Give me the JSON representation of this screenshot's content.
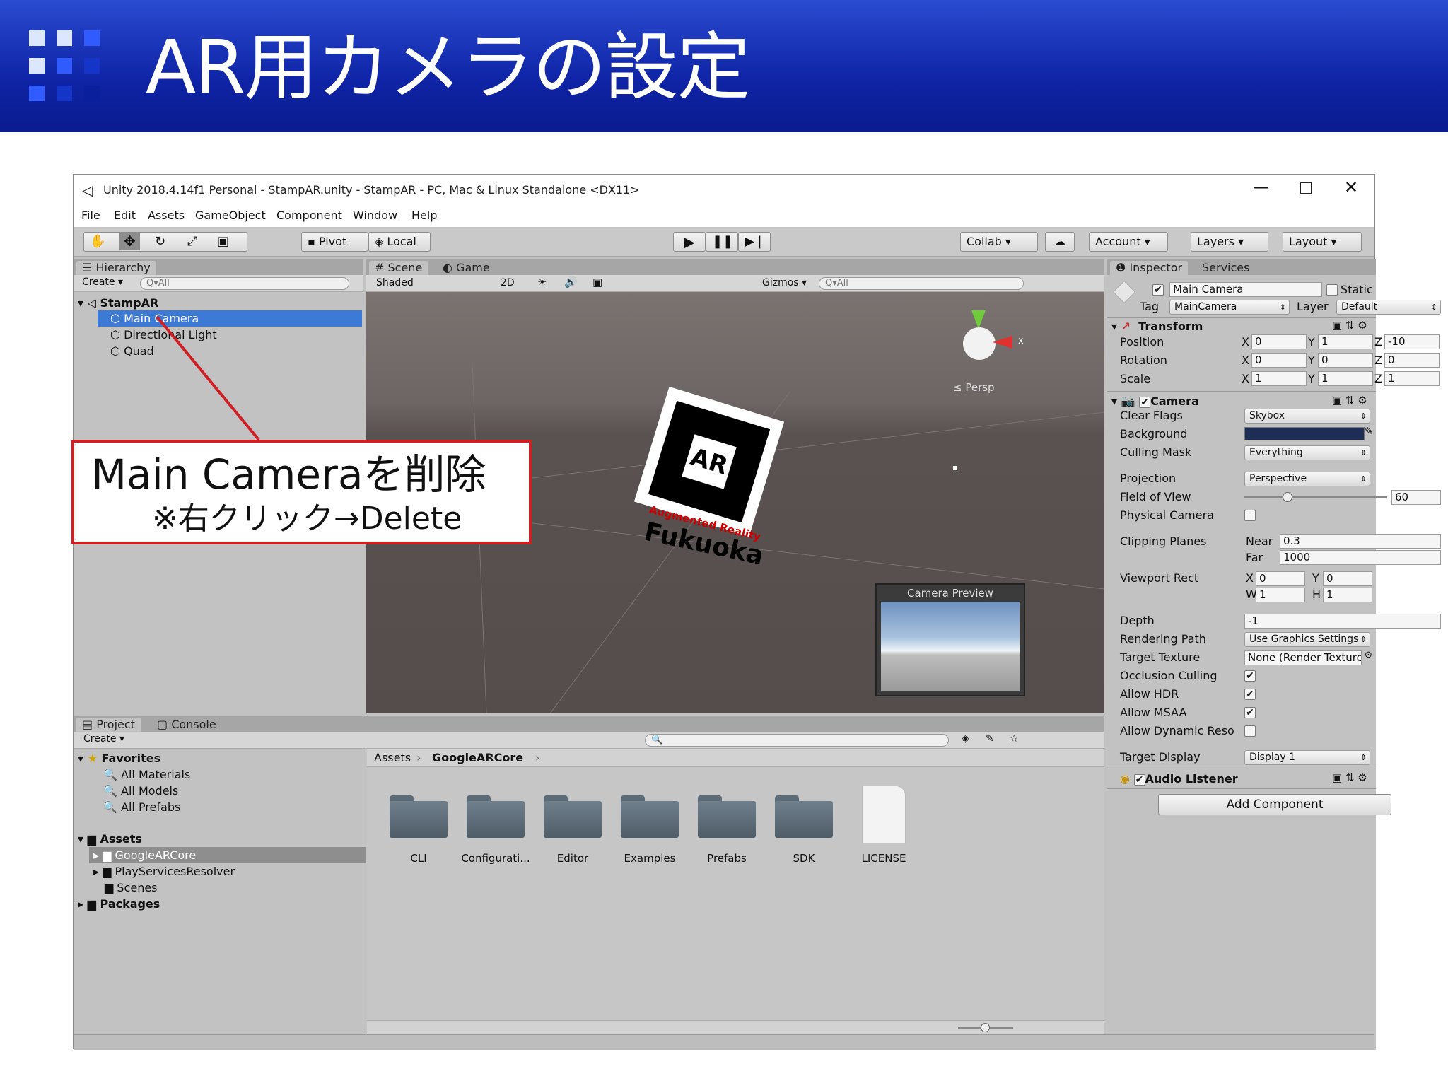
{
  "slide": {
    "title": "AR用カメラの設定"
  },
  "window": {
    "title": "Unity 2018.4.14f1 Personal - StampAR.unity - StampAR - PC, Mac & Linux Standalone <DX11>",
    "menu": [
      "File",
      "Edit",
      "Assets",
      "GameObject",
      "Component",
      "Window",
      "Help"
    ],
    "toolbar": {
      "pivot": "Pivot",
      "local": "Local",
      "collab": "Collab ▾",
      "account": "Account",
      "layers": "Layers",
      "layout": "Layout"
    }
  },
  "hierarchy": {
    "tab": "Hierarchy",
    "create": "Create ▾",
    "search": "Q▾All",
    "scene": "StampAR",
    "items": [
      "Main Camera",
      "Directional Light",
      "Quad"
    ]
  },
  "scene": {
    "tabs": [
      "Scene",
      "Game"
    ],
    "shading": "Shaded",
    "mode2d": "2D",
    "gizmos": "Gizmos ▾",
    "search": "Q▾All",
    "persp": "≤ Persp",
    "marker_text": "AR",
    "marker_sub": "Augmented Reality",
    "marker_city": "Fukuoka",
    "preview_title": "Camera Preview"
  },
  "callout": {
    "main": "Main Cameraを削除",
    "sub": "※右クリック→Delete"
  },
  "inspector": {
    "tabs": [
      "Inspector",
      "Services"
    ],
    "object_name": "Main Camera",
    "static": "Static",
    "tag_label": "Tag",
    "tag": "MainCamera",
    "layer_label": "Layer",
    "layer": "Default",
    "transform": {
      "title": "Transform",
      "rows": [
        {
          "label": "Position",
          "x": "0",
          "y": "1",
          "z": "-10"
        },
        {
          "label": "Rotation",
          "x": "0",
          "y": "0",
          "z": "0"
        },
        {
          "label": "Scale",
          "x": "1",
          "y": "1",
          "z": "1"
        }
      ]
    },
    "camera": {
      "title": "Camera",
      "clear_flags_label": "Clear Flags",
      "clear_flags": "Skybox",
      "background_label": "Background",
      "background_color": "#1d2d55",
      "culling_label": "Culling Mask",
      "culling": "Everything",
      "projection_label": "Projection",
      "projection": "Perspective",
      "fov_label": "Field of View",
      "fov": "60",
      "fov_fraction": 0.3,
      "physical_label": "Physical Camera",
      "clipping_label": "Clipping Planes",
      "near_label": "Near",
      "near": "0.3",
      "far_label": "Far",
      "far": "1000",
      "viewport_label": "Viewport Rect",
      "vx": "0",
      "vy": "0",
      "vw": "1",
      "vh": "1",
      "depth_label": "Depth",
      "depth": "-1",
      "rendering_label": "Rendering Path",
      "rendering": "Use Graphics Settings",
      "target_tex_label": "Target Texture",
      "target_tex": "None (Render Texture)",
      "occlusion_label": "Occlusion Culling",
      "hdr_label": "Allow HDR",
      "msaa_label": "Allow MSAA",
      "dynres_label": "Allow Dynamic Reso",
      "display_label": "Target Display",
      "display": "Display 1"
    },
    "audio": "Audio Listener",
    "add_component": "Add Component"
  },
  "project": {
    "tabs": [
      "Project",
      "Console"
    ],
    "create": "Create ▾",
    "favorites": "Favorites",
    "fav_items": [
      "All Materials",
      "All Models",
      "All Prefabs"
    ],
    "assets": "Assets",
    "asset_items": [
      "GoogleARCore",
      "PlayServicesResolver",
      "Scenes"
    ],
    "packages": "Packages",
    "breadcrumb": [
      "Assets",
      "GoogleARCore"
    ],
    "folders": [
      "CLI",
      "Configurati...",
      "Editor",
      "Examples",
      "Prefabs",
      "SDK"
    ],
    "file": "LICENSE"
  }
}
